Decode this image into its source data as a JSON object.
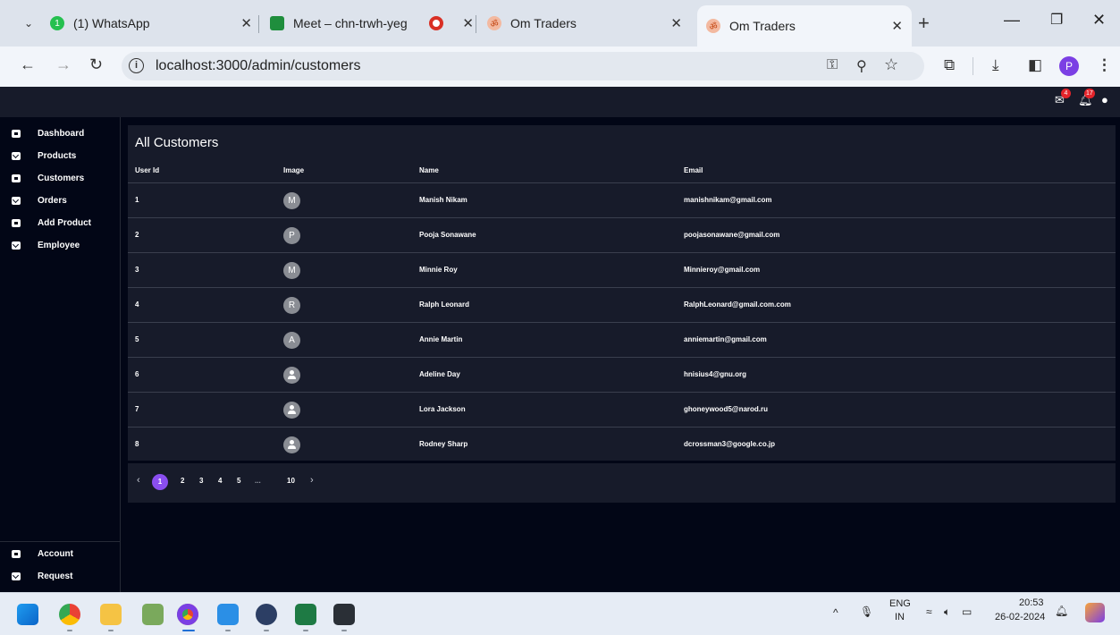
{
  "browser": {
    "tabs": [
      {
        "title": "(1) WhatsApp",
        "favicon": "whatsapp-icon",
        "badge": "1"
      },
      {
        "title": "Meet – chn-trwh-yeg",
        "favicon": "meet-icon"
      },
      {
        "title": "",
        "favicon": "recording-icon"
      },
      {
        "title": "Om Traders",
        "favicon": "om-icon"
      },
      {
        "title": "Om Traders",
        "favicon": "om-icon"
      }
    ],
    "url": "localhost:3000/admin/customers",
    "profile_initial": "P"
  },
  "app": {
    "header": {
      "mail_badge": "4",
      "notify_badge": "17"
    },
    "sidebar": {
      "items": [
        {
          "label": "Dashboard",
          "icon": "inbox-icon"
        },
        {
          "label": "Products",
          "icon": "mail-icon"
        },
        {
          "label": "Customers",
          "icon": "inbox-icon"
        },
        {
          "label": "Orders",
          "icon": "mail-icon"
        },
        {
          "label": "Add Product",
          "icon": "inbox-icon"
        },
        {
          "label": "Employee",
          "icon": "mail-icon"
        }
      ],
      "bottom_items": [
        {
          "label": "Account",
          "icon": "inbox-icon"
        },
        {
          "label": "Request",
          "icon": "mail-icon"
        }
      ]
    },
    "customers": {
      "title": "All Customers",
      "columns": [
        "User Id",
        "Image",
        "Name",
        "Email"
      ],
      "rows": [
        {
          "id": "1",
          "avatar": "M",
          "name": "Manish Nikam",
          "email": "manishnikam@gmail.com"
        },
        {
          "id": "2",
          "avatar": "P",
          "name": "Pooja Sonawane",
          "email": "poojasonawane@gmail.com"
        },
        {
          "id": "3",
          "avatar": "M",
          "name": "Minnie Roy",
          "email": "Minnieroy@gmail.com"
        },
        {
          "id": "4",
          "avatar": "R",
          "name": "Ralph Leonard",
          "email": "RalphLeonard@gmail.com.com"
        },
        {
          "id": "5",
          "avatar": "A",
          "name": "Annie Martin",
          "email": "anniemartin@gmail.com"
        },
        {
          "id": "6",
          "avatar": "",
          "name": "Adeline Day",
          "email": "hnisius4@gnu.org"
        },
        {
          "id": "7",
          "avatar": "",
          "name": "Lora Jackson",
          "email": "ghoneywood5@narod.ru"
        },
        {
          "id": "8",
          "avatar": "",
          "name": "Rodney Sharp",
          "email": "dcrossman3@google.co.jp"
        }
      ]
    },
    "pagination": {
      "prev": "‹",
      "current": "1",
      "pages": [
        "2",
        "3",
        "4",
        "5"
      ],
      "ellipsis": "...",
      "last": "10",
      "next": "›"
    }
  },
  "taskbar": {
    "lang_top": "ENG",
    "lang_bottom": "IN",
    "time": "20:53",
    "date": "26-02-2024"
  },
  "colors": {
    "app_bg": "#020616",
    "panel_bg": "#171b2a",
    "accent": "#8a4ef0",
    "badge": "#e3242b"
  }
}
